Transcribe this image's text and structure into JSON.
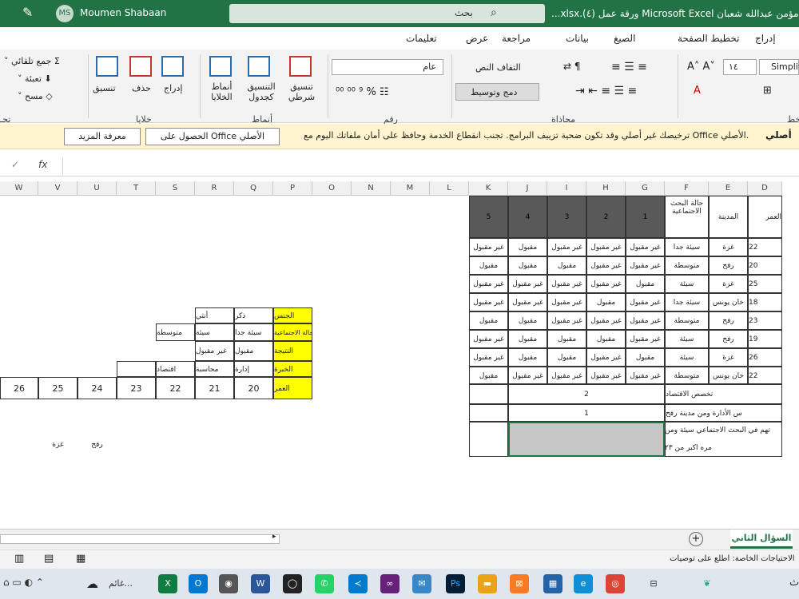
{
  "title_bar": {
    "document_title": "...xlsx.(٤) ورقة عمل Microsoft Excel جديد مؤمن عبدالله شعبان",
    "search_placeholder": "بحث",
    "user_initials": "MS",
    "user_name": "Moumen Shabaan"
  },
  "menu": {
    "tabs": [
      "إدراج",
      "تخطيط الصفحة",
      "الصيغ",
      "بيانات",
      "مراجعة",
      "عرض",
      "تعليمات"
    ]
  },
  "ribbon": {
    "font_name": "Simplifi",
    "font_size": "١٤",
    "wrap_text": "التفاف النص",
    "merge_center": "دمج وتوسيط",
    "number_format": "عام",
    "conditional_format": "تنسيق شرطي",
    "format_as_table": "التنسيق كجدول",
    "cell_styles": "أنماط الخلايا",
    "insert": "إدراج",
    "delete": "حذف",
    "format": "تنسيق",
    "autosum": "جمع تلقائي",
    "fill": "تعبئة",
    "clear": "مسح",
    "groups": {
      "font": "خط",
      "alignment": "محاذاة",
      "number": "رقم",
      "styles": "أنماط",
      "cells": "خلايا",
      "editing": "تحـ"
    }
  },
  "message_bar": {
    "label": "أصلي",
    "text": "ترخيصك غير أصلي وقد تكون ضحية تزييف البرامج. تجنب انقطاع الخدمة وحافظ على أمان ملفاتك اليوم مع Office الأصلي.",
    "get_genuine": "الحصول على Office الأصلي",
    "learn_more": "معرفة المزيد"
  },
  "formula_bar": {
    "fx": "fx",
    "check": "✓"
  },
  "columns": [
    "W",
    "V",
    "U",
    "T",
    "S",
    "R",
    "Q",
    "P",
    "O",
    "N",
    "M",
    "L",
    "K",
    "J",
    "I",
    "H",
    "G",
    "F",
    "E",
    "D"
  ],
  "table": {
    "headers": {
      "D": "العمر",
      "E": "المدينة",
      "F": "حالة البحث الاجتماعية",
      "G": "1",
      "H": "2",
      "I": "3",
      "J": "4",
      "K": "5"
    },
    "rows": [
      [
        "22",
        "غزة",
        "سيئة جدا",
        "غير مقبول",
        "غير مقبول",
        "غير مقبول",
        "مقبول",
        "غير مقبول"
      ],
      [
        "20",
        "رفح",
        "متوسطة",
        "غير مقبول",
        "غير مقبول",
        "مقبول",
        "مقبول",
        "مقبول"
      ],
      [
        "25",
        "غزة",
        "سيئة",
        "مقبول",
        "غير مقبول",
        "غير مقبول",
        "غير مقبول",
        "غير مقبول"
      ],
      [
        "18",
        "خان يونس",
        "سيئة جدا",
        "غير مقبول",
        "مقبول",
        "غير مقبول",
        "غير مقبول",
        "غير مقبول"
      ],
      [
        "23",
        "رفح",
        "متوسطة",
        "غير مقبول",
        "غير مقبول",
        "غير مقبول",
        "مقبول",
        "مقبول"
      ],
      [
        "19",
        "رفح",
        "سيئة",
        "غير مقبول",
        "مقبول",
        "مقبول",
        "مقبول",
        "غير مقبول"
      ],
      [
        "26",
        "غزة",
        "سيئة",
        "مقبول",
        "غير مقبول",
        "مقبول",
        "مقبول",
        "غير مقبول"
      ],
      [
        "22",
        "خان يونس",
        "متوسطة",
        "غير مقبول",
        "غير مقبول",
        "غير مقبول",
        "غير مقبول",
        "مقبول"
      ]
    ],
    "questions": [
      {
        "text": "تخصص الاقتصاد",
        "value": "2"
      },
      {
        "text": "س الأدارة ومن مدينة رفح",
        "value": "1"
      },
      {
        "text": "تهم في البحث الاجتماعي سيئة ومن",
        "value": ""
      },
      {
        "text": "مره اكبر من ٢٣",
        "value": ""
      }
    ]
  },
  "criteria": {
    "gender": {
      "label": "الجنس",
      "values": [
        "ذكر",
        "أنثي"
      ]
    },
    "social": {
      "label": "الحالة الاجتماعية",
      "values": [
        "سيئة جدا",
        "سيئة",
        "متوسطة"
      ]
    },
    "result": {
      "label": "النتيجة",
      "values": [
        "مقبول",
        "غير مقبول"
      ]
    },
    "experience": {
      "label": "الخبرة",
      "values": [
        "إدارة",
        "محاسبة",
        "اقتصاد"
      ]
    },
    "age": {
      "label": "العمر",
      "values": [
        "20",
        "21",
        "22",
        "23",
        "24",
        "25",
        "26"
      ]
    },
    "cities": [
      "رفح",
      "غزة"
    ]
  },
  "sheet": {
    "active_tab": "السؤال الثاني",
    "add": "+"
  },
  "status": {
    "text": "الاحتياجات الخاصة: اطلع على توصيات"
  },
  "taskbar": {
    "weather": "غائم..."
  },
  "colors": {
    "excel_green": "#217346",
    "highlight_yellow": "#ffff00",
    "header_dark": "#595959",
    "message_bar": "#fff4ce"
  }
}
